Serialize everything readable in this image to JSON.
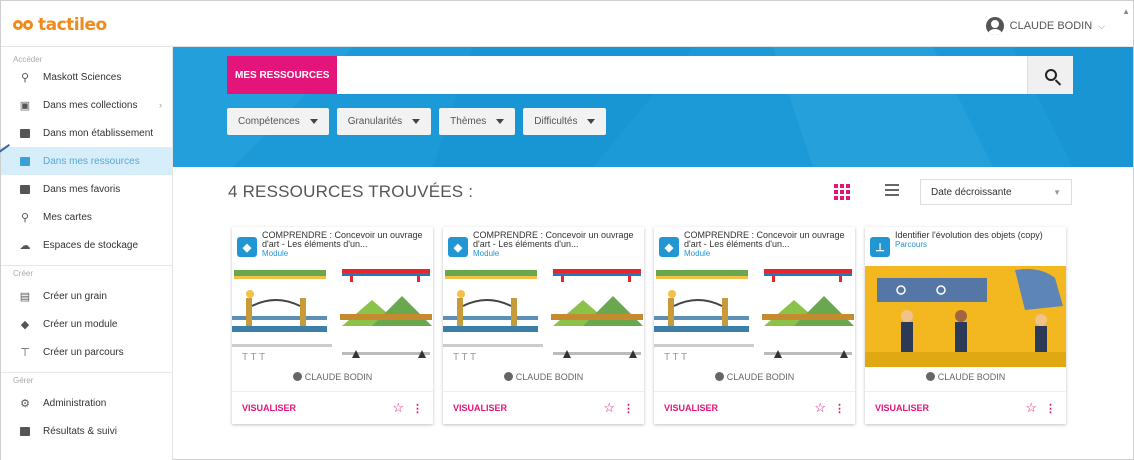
{
  "header": {
    "logo_text": "tactileo",
    "user_name": "CLAUDE BODIN"
  },
  "sidebar": {
    "sections": {
      "acceder": "Accéder",
      "creer": "Créer",
      "gerer": "Gérer"
    },
    "acceder_items": [
      {
        "label": "Maskott Sciences",
        "icon": "search-icon"
      },
      {
        "label": "Dans mes collections",
        "icon": "collections-icon"
      },
      {
        "label": "Dans mon établissement",
        "icon": "folder-icon"
      },
      {
        "label": "Dans mes ressources",
        "icon": "folder-icon"
      },
      {
        "label": "Dans mes favoris",
        "icon": "folder-icon"
      },
      {
        "label": "Mes cartes",
        "icon": "map-pin-icon"
      },
      {
        "label": "Espaces de stockage",
        "icon": "cloud-icon"
      }
    ],
    "creer_items": [
      {
        "label": "Créer un grain",
        "icon": "grain-icon"
      },
      {
        "label": "Créer un module",
        "icon": "module-icon"
      },
      {
        "label": "Créer un parcours",
        "icon": "parcours-icon"
      }
    ],
    "gerer_items": [
      {
        "label": "Administration",
        "icon": "gear-icon"
      },
      {
        "label": "Résultats & suivi",
        "icon": "chart-icon"
      }
    ]
  },
  "search": {
    "tag": "MES RESSOURCES",
    "value": ""
  },
  "filters": [
    "Compétences",
    "Granularités",
    "Thèmes",
    "Difficultés"
  ],
  "results": {
    "title": "4 RESSOURCES TROUVÉES :",
    "sort": "Date décroissante"
  },
  "cards": [
    {
      "title": "COMPRENDRE : Concevoir un ouvrage d'art - Les éléments d'un...",
      "type": "Module",
      "author": "CLAUDE BODIN",
      "action": "VISUALISER"
    },
    {
      "title": "COMPRENDRE : Concevoir un ouvrage d'art - Les éléments d'un...",
      "type": "Module",
      "author": "CLAUDE BODIN",
      "action": "VISUALISER"
    },
    {
      "title": "COMPRENDRE : Concevoir un ouvrage d'art - Les éléments d'un...",
      "type": "Module",
      "author": "CLAUDE BODIN",
      "action": "VISUALISER"
    },
    {
      "title": "Identifier l'évolution des objets (copy)",
      "type": "Parcours",
      "author": "CLAUDE BODIN",
      "action": "VISUALISER"
    }
  ],
  "colors": {
    "accent": "#e4157a",
    "hero": "#1c9ad8",
    "brand": "#f08a1c",
    "active_bg": "#d6eef9"
  }
}
